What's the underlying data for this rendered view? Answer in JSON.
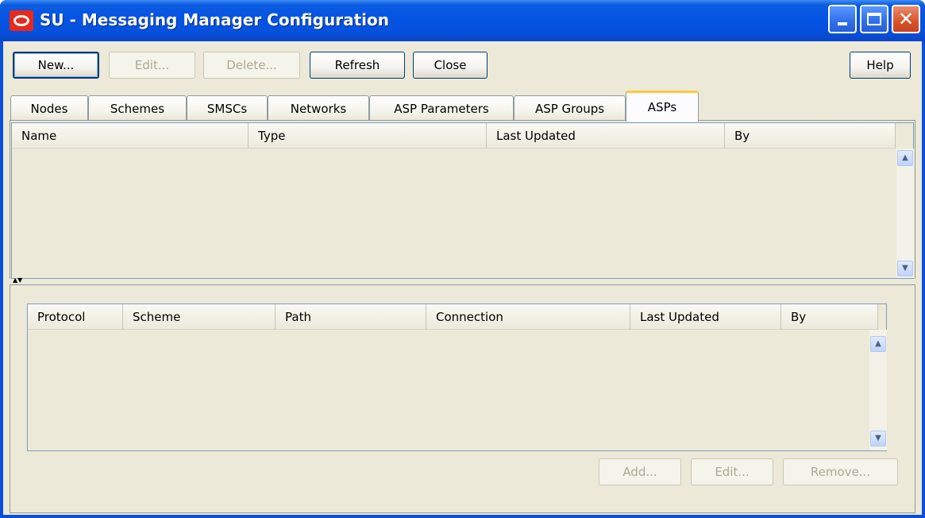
{
  "window": {
    "title": "SU - Messaging Manager Configuration",
    "accent": "#0554e3",
    "logo_color": "#e8291c"
  },
  "toolbar": {
    "new_label": "New...",
    "edit_label": "Edit...",
    "delete_label": "Delete...",
    "refresh_label": "Refresh",
    "close_label": "Close",
    "help_label": "Help"
  },
  "tabs": [
    "Nodes",
    "Schemes",
    "SMSCs",
    "Networks",
    "ASP Parameters",
    "ASP Groups",
    "ASPs"
  ],
  "active_tab": "ASPs",
  "asp_table": {
    "columns": [
      "Name",
      "Type",
      "Last Updated",
      "By"
    ],
    "rows": []
  },
  "detail_table": {
    "columns": [
      "Protocol",
      "Scheme",
      "Path",
      "Connection",
      "Last Updated",
      "By"
    ],
    "rows": []
  },
  "detail_buttons": {
    "add_label": "Add...",
    "edit_label": "Edit...",
    "remove_label": "Remove..."
  },
  "icons": {
    "title_logo": "oracle-logo-icon",
    "minimize": "minimize-icon",
    "maximize": "maximize-icon",
    "close": "close-icon",
    "scroll_up": "chevron-up-icon",
    "scroll_down": "chevron-down-icon"
  }
}
